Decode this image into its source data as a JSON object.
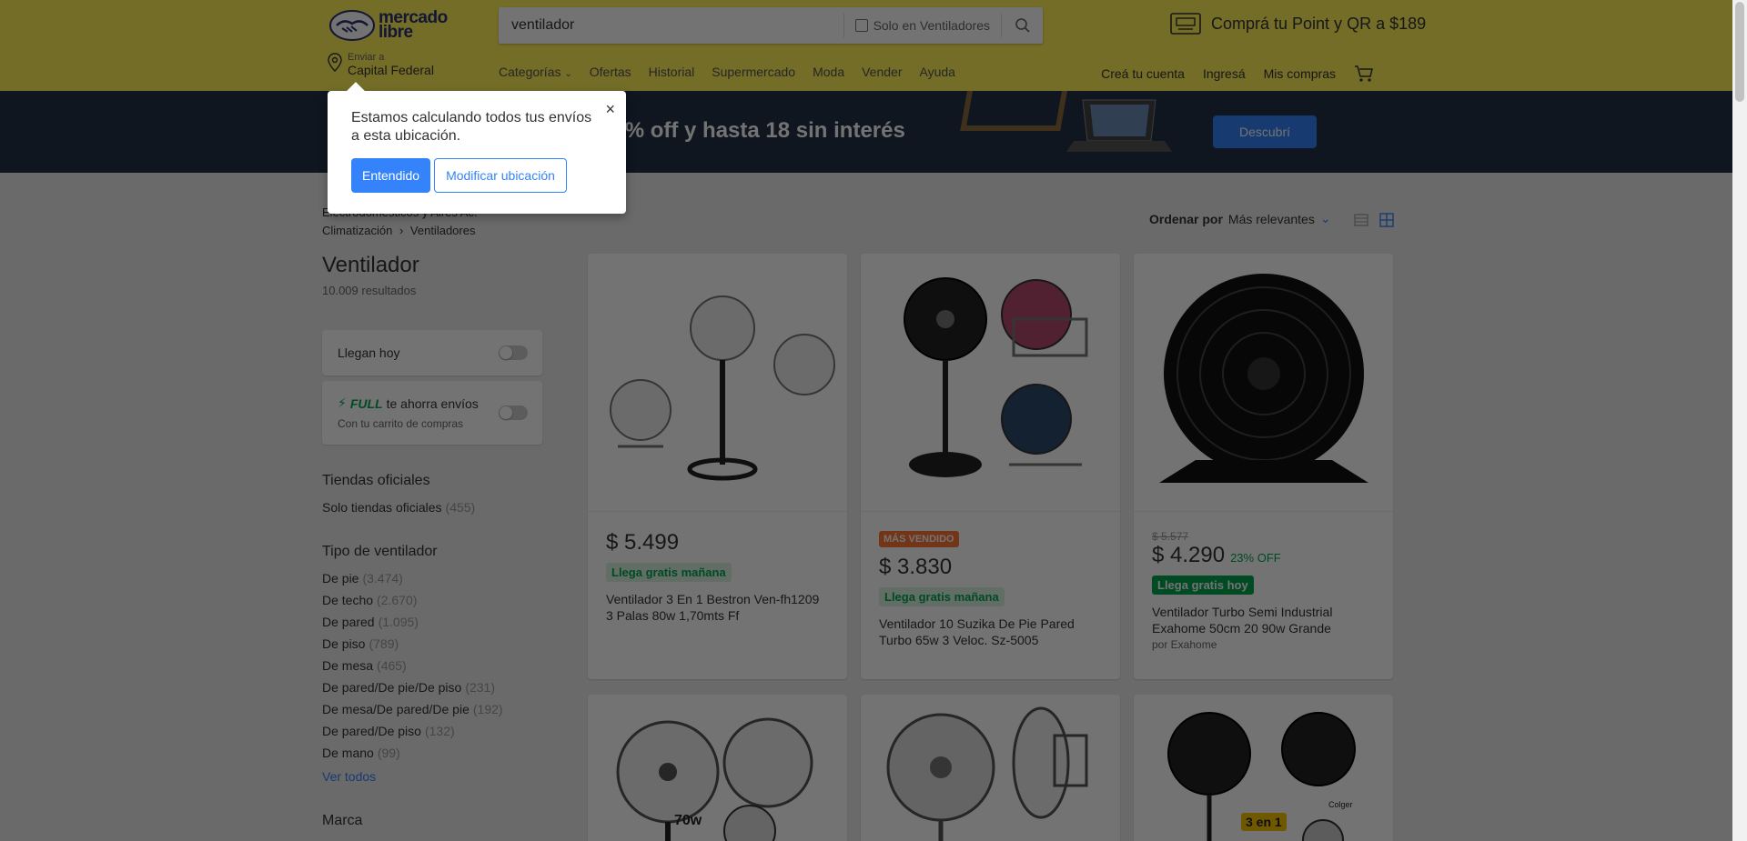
{
  "header": {
    "logo_line1": "mercado",
    "logo_line2": "libre",
    "search_value": "ventilador",
    "search_filter_label": "Solo en Ventiladores",
    "promo_text": "Comprá tu Point y QR a $189",
    "location_small": "Enviar a",
    "location_big": "Capital Federal",
    "nav": [
      "Categorías",
      "Ofertas",
      "Historial",
      "Supermercado",
      "Moda",
      "Vender",
      "Ayuda"
    ],
    "user_nav": [
      "Creá tu cuenta",
      "Ingresá",
      "Mis compras"
    ]
  },
  "banner": {
    "text": "a 40% off y hasta 18 sin interés",
    "button": "Descubrí"
  },
  "popup": {
    "text": "Estamos calculando todos tus envíos a esta ubicación.",
    "primary": "Entendido",
    "secondary": "Modificar ubicación",
    "close": "×"
  },
  "sidebar": {
    "breadcrumb_line1": "Electrodomésticos y Aires Ac.",
    "breadcrumb_item1": "Climatización",
    "breadcrumb_item2": "Ventiladores",
    "title": "Ventilador",
    "results": "10.009 resultados",
    "llegan_hoy": "Llegan hoy",
    "full_label": "FULL",
    "full_text": "te ahorra envíos",
    "full_sub": "Con tu carrito de compras",
    "tiendas_title": "Tiendas oficiales",
    "tiendas_item": "Solo tiendas oficiales",
    "tiendas_count": "(455)",
    "tipo_title": "Tipo de ventilador",
    "tipos": [
      {
        "label": "De pie",
        "count": "(3.474)"
      },
      {
        "label": "De techo",
        "count": "(2.670)"
      },
      {
        "label": "De pared",
        "count": "(1.095)"
      },
      {
        "label": "De piso",
        "count": "(789)"
      },
      {
        "label": "De mesa",
        "count": "(465)"
      },
      {
        "label": "De pared/De pie/De piso",
        "count": "(231)"
      },
      {
        "label": "De mesa/De pared/De pie",
        "count": "(192)"
      },
      {
        "label": "De pared/De piso",
        "count": "(132)"
      },
      {
        "label": "De mano",
        "count": "(99)"
      }
    ],
    "ver_todos": "Ver todos",
    "marca_title": "Marca"
  },
  "sort": {
    "label": "Ordenar por",
    "value": "Más relevantes"
  },
  "products": [
    {
      "price": "$ 5.499",
      "shipping": "Llega gratis mañana",
      "title": "Ventilador 3 En 1 Bestron Ven-fh1209 3 Palas 80w 1,70mts Ff"
    },
    {
      "badge": "MÁS VENDIDO",
      "price": "$ 3.830",
      "shipping": "Llega gratis mañana",
      "title": "Ventilador 10 Suzika De Pie Pared Turbo 65w 3 Veloc. Sz-5005"
    },
    {
      "old_price": "$ 5.577",
      "price": "$ 4.290",
      "discount": "23% OFF",
      "shipping": "Llega gratis hoy",
      "title": "Ventilador Turbo Semi Industrial Exahome 50cm 20 90w Grande",
      "seller": "por Exahome"
    }
  ],
  "row2_tags": {
    "watt": "70w",
    "combo": "3 en 1",
    "brand": "Colger"
  },
  "colors": {
    "header": "#fff159",
    "accent": "#3483fa",
    "green": "#00a650",
    "orange": "#ff7733"
  }
}
